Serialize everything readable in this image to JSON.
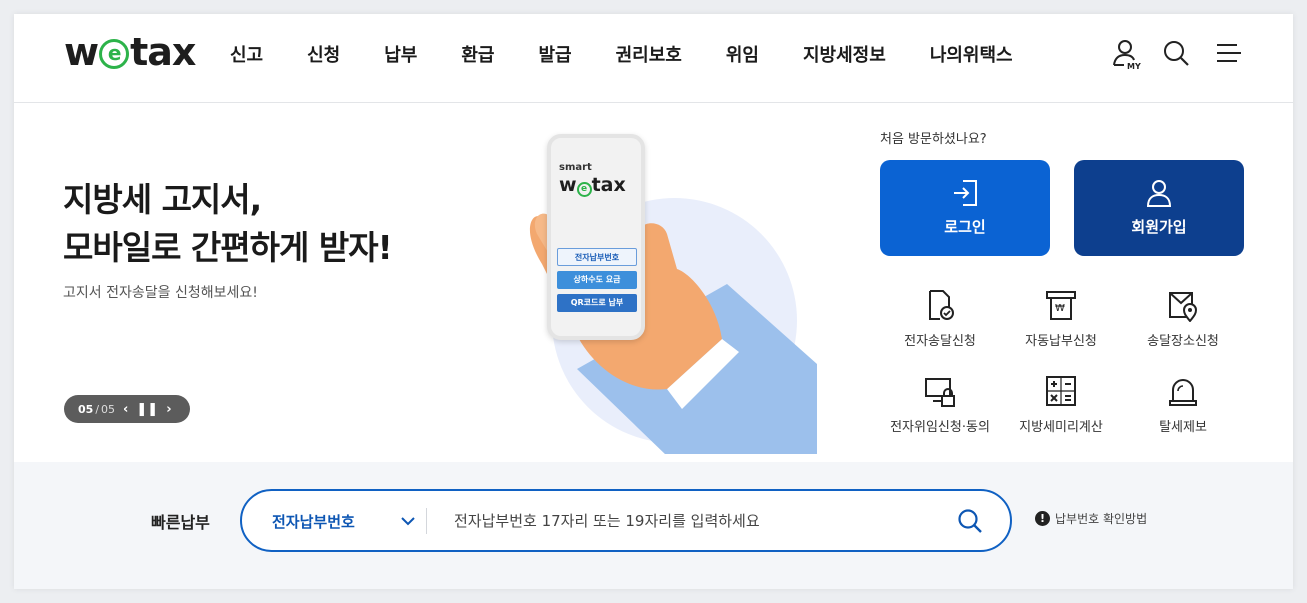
{
  "header": {
    "logo": {
      "pre": "w",
      "mid": "e",
      "post": "tax"
    },
    "nav": [
      "신고",
      "신청",
      "납부",
      "환급",
      "발급",
      "권리보호",
      "위임",
      "지방세정보",
      "나의위택스"
    ],
    "my_label": "MY",
    "icons": [
      "user-my-icon",
      "search-icon",
      "menu-icon"
    ]
  },
  "hero": {
    "title_line1": "지방세 고지서,",
    "title_line2": "모바일로 간편하게 받자!",
    "subtitle": "고지서 전자송달을 신청해보세요!",
    "slider": {
      "current": "05",
      "separator": "/",
      "total": "05"
    },
    "phone": {
      "smart": "smart",
      "logo_pre": "w",
      "logo_mid": "e",
      "logo_post": "tax",
      "buttons": [
        "전자납부번호",
        "상하수도 요금",
        "QR코드로 납부"
      ]
    }
  },
  "side": {
    "visit_text": "처음 방문하셨나요?",
    "login_label": "로그인",
    "join_label": "회원가입",
    "services": [
      {
        "label": "전자송달신청",
        "icon": "e-delivery-icon"
      },
      {
        "label": "자동납부신청",
        "icon": "auto-pay-icon"
      },
      {
        "label": "송달장소신청",
        "icon": "delivery-place-icon"
      },
      {
        "label": "전자위임신청·동의",
        "icon": "e-delegation-icon"
      },
      {
        "label": "지방세미리계산",
        "icon": "calculator-icon"
      },
      {
        "label": "탈세제보",
        "icon": "alarm-icon"
      }
    ]
  },
  "quick": {
    "label": "빠른납부",
    "select_value": "전자납부번호",
    "placeholder": "전자납부번호 17자리 또는 19자리를 입력하세요",
    "help_mark": "!",
    "help_text": "납부번호 확인방법"
  },
  "colors": {
    "login": "#0b63d3",
    "join": "#0d3f8e",
    "logo_e": "#2db34a",
    "quick_border": "#1061c3"
  }
}
